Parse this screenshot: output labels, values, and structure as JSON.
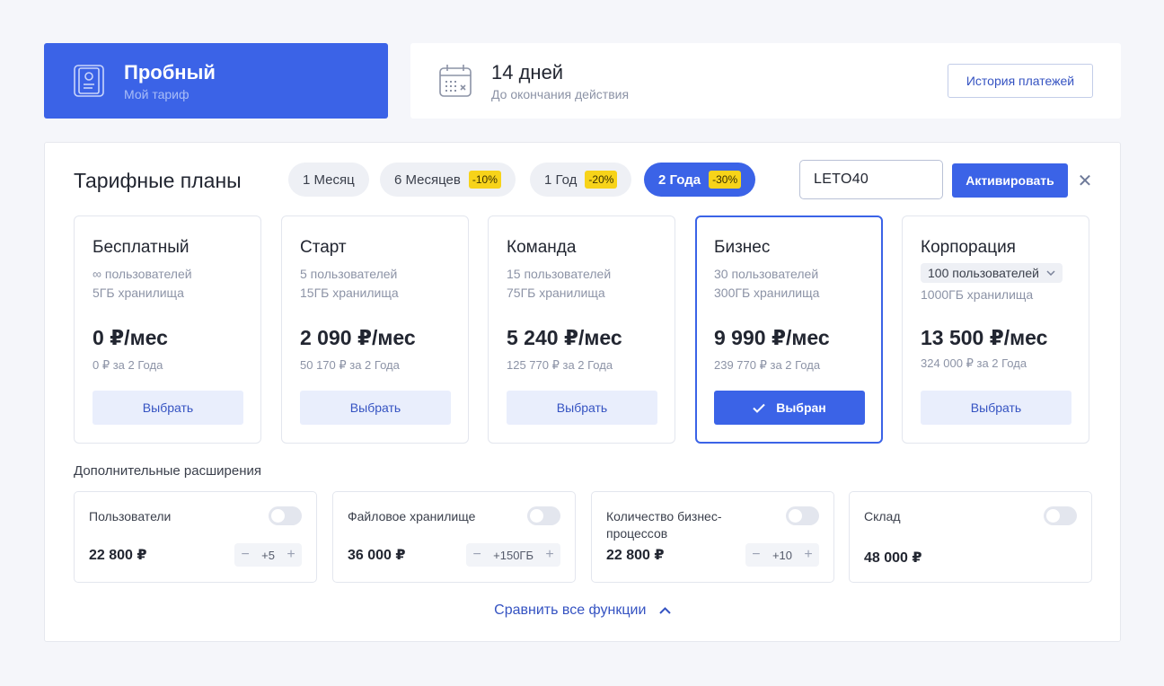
{
  "current_plan": {
    "title": "Пробный",
    "subtitle": "Мой тариф"
  },
  "trial": {
    "days": "14 дней",
    "subtitle": "До окончания действия",
    "history_label": "История платежей"
  },
  "pricing": {
    "title": "Тарифные планы",
    "periods": [
      {
        "label": "1 Месяц",
        "discount": ""
      },
      {
        "label": "6 Месяцев",
        "discount": "-10%"
      },
      {
        "label": "1 Год",
        "discount": "-20%"
      },
      {
        "label": "2 Года",
        "discount": "-30%",
        "active": true
      }
    ],
    "promo": {
      "value": "LETO40",
      "activate_label": "Активировать",
      "close_glyph": "✕"
    }
  },
  "tariffs": [
    {
      "name": "Бесплатный",
      "users": "∞ пользователей",
      "storage": "5ГБ хранилища",
      "price": "0 ₽/мес",
      "total": "0 ₽ за 2 Года",
      "button": "Выбрать"
    },
    {
      "name": "Старт",
      "users": "5 пользователей",
      "storage": "15ГБ хранилища",
      "price": "2 090 ₽/мес",
      "total": "50 170 ₽ за 2 Года",
      "button": "Выбрать"
    },
    {
      "name": "Команда",
      "users": "15 пользователей",
      "storage": "75ГБ хранилища",
      "price": "5 240 ₽/мес",
      "total": "125 770 ₽ за 2 Года",
      "button": "Выбрать"
    },
    {
      "name": "Бизнес",
      "users": "30 пользователей",
      "storage": "300ГБ хранилища",
      "price": "9 990 ₽/мес",
      "total": "239 770 ₽ за 2 Года",
      "button": "Выбран",
      "selected": true
    },
    {
      "name": "Корпорация",
      "users": "100 пользователей",
      "storage": "1000ГБ хранилища",
      "price": "13 500 ₽/мес",
      "total": "324 000 ₽ за 2 Года",
      "button": "Выбрать"
    }
  ],
  "extensions": {
    "title": "Дополнительные расширения",
    "items": [
      {
        "name": "Пользователи",
        "price": "22 800 ₽",
        "step": "+5"
      },
      {
        "name": "Файловое хранилище",
        "price": "36 000 ₽",
        "step": "+150ГБ"
      },
      {
        "name": "Количество бизнес-процессов",
        "price": "22 800 ₽",
        "step": "+10"
      },
      {
        "name": "Склад",
        "price": "48 000 ₽",
        "step": ""
      }
    ],
    "stepper_minus": "−",
    "stepper_plus": "+"
  },
  "compare_label": "Сравнить все функции",
  "icons": {
    "plan": "id-card-icon",
    "calendar": "calendar-icon",
    "check": "check-icon",
    "chevron_down": "chevron-down-icon",
    "chevron_up": "chevron-up-icon",
    "close": "close-icon"
  },
  "colors": {
    "accent": "#3b63e7",
    "discount_badge": "#f7d31a",
    "background": "#f5f6fa"
  }
}
